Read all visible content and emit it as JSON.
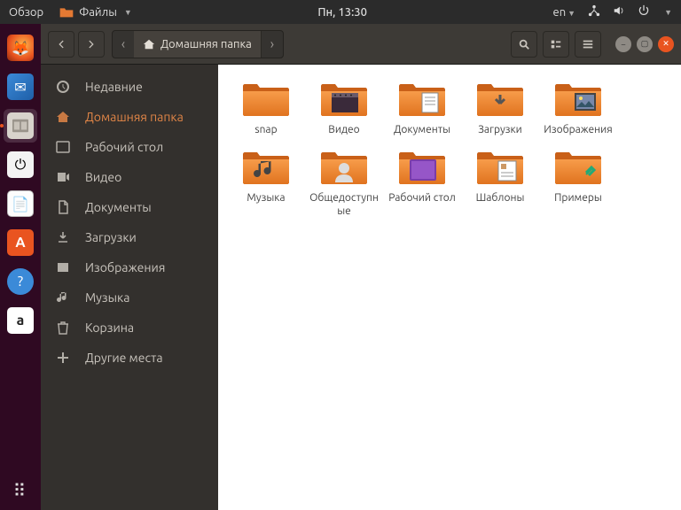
{
  "top_panel": {
    "activities": "Обзор",
    "app_name": "Файлы",
    "clock": "Пн, 13:30",
    "lang": "en"
  },
  "headerbar": {
    "location_label": "Домашняя папка"
  },
  "sidebar": {
    "items": [
      {
        "id": "recent",
        "label": "Недавние"
      },
      {
        "id": "home",
        "label": "Домашняя папка"
      },
      {
        "id": "desktop",
        "label": "Рабочий стол"
      },
      {
        "id": "videos",
        "label": "Видео"
      },
      {
        "id": "documents",
        "label": "Документы"
      },
      {
        "id": "downloads",
        "label": "Загрузки"
      },
      {
        "id": "pictures",
        "label": "Изображения"
      },
      {
        "id": "music",
        "label": "Музыка"
      },
      {
        "id": "trash",
        "label": "Корзина"
      },
      {
        "id": "other",
        "label": "Другие места"
      }
    ]
  },
  "folders": [
    {
      "id": "snap",
      "label": "snap",
      "emblem": "plain"
    },
    {
      "id": "videos",
      "label": "Видео",
      "emblem": "video"
    },
    {
      "id": "documents",
      "label": "Документы",
      "emblem": "doc"
    },
    {
      "id": "downloads",
      "label": "Загрузки",
      "emblem": "down"
    },
    {
      "id": "pictures",
      "label": "Изображения",
      "emblem": "pic"
    },
    {
      "id": "music",
      "label": "Музыка",
      "emblem": "music"
    },
    {
      "id": "public",
      "label": "Общедоступные",
      "emblem": "public"
    },
    {
      "id": "desktop",
      "label": "Рабочий стол",
      "emblem": "desktop"
    },
    {
      "id": "templates",
      "label": "Шаблоны",
      "emblem": "template"
    },
    {
      "id": "examples",
      "label": "Примеры",
      "emblem": "link"
    }
  ]
}
